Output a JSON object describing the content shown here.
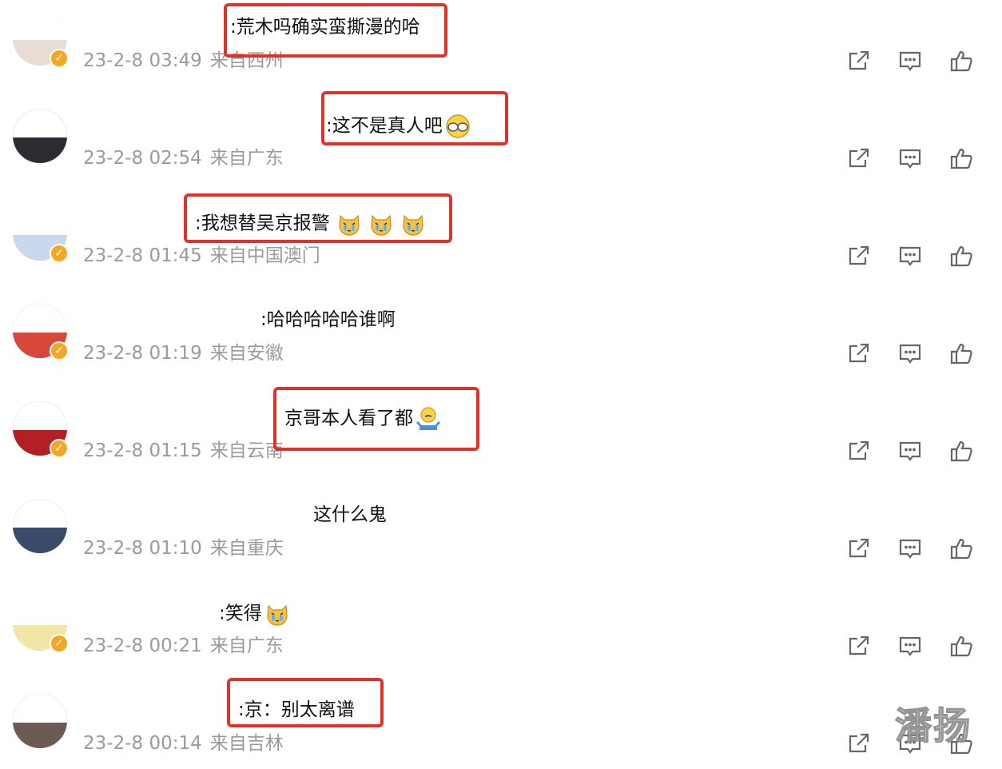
{
  "comments": [
    {
      "text": ":荒木吗确实蛮撕漫的哈",
      "time": "23-2-8 03:49",
      "location": "来自西州",
      "verified": true,
      "highlighted": true,
      "emoji": null,
      "avatar_color": "#e9dcd4"
    },
    {
      "text": ":这不是真人吧",
      "time": "23-2-8 02:54",
      "location": "来自广东",
      "verified": false,
      "highlighted": true,
      "emoji": "covering-eyes-emoji",
      "avatar_color": "#2c2c33"
    },
    {
      "text": ":我想替吴京报警",
      "time": "23-2-8 01:45",
      "location": "来自中国澳门",
      "verified": true,
      "highlighted": true,
      "emoji": "crying-dog-emoji",
      "avatar_color": "#c9d8ec"
    },
    {
      "text": ":哈哈哈哈哈谁啊",
      "time": "23-2-8 01:19",
      "location": "来自安徽",
      "verified": true,
      "highlighted": false,
      "emoji": null,
      "avatar_color": "#d9463a"
    },
    {
      "text": "京哥本人看了都",
      "time": "23-2-8 01:15",
      "location": "来自云南",
      "verified": true,
      "highlighted": true,
      "emoji": "shrug-emoji",
      "avatar_color": "#b21f24"
    },
    {
      "text": "这什么鬼",
      "time": "23-2-8 01:10",
      "location": "来自重庆",
      "verified": false,
      "highlighted": false,
      "emoji": null,
      "avatar_color": "#3a4a6a"
    },
    {
      "text": ":笑得",
      "time": "23-2-8 00:21",
      "location": "来自广东",
      "verified": true,
      "highlighted": false,
      "emoji": "crying-dog-emoji",
      "avatar_color": "#f2e6a6"
    },
    {
      "text": ":京：别太离谱",
      "time": "23-2-8 00:14",
      "location": "来自吉林",
      "verified": false,
      "highlighted": true,
      "emoji": null,
      "avatar_color": "#6b5a55"
    }
  ],
  "actions": {
    "share_icon": "share-icon",
    "reply_icon": "comment-icon",
    "like_icon": "thumbs-up-icon"
  },
  "colors": {
    "highlight_border": "#e03228",
    "meta_text": "#9a9a9a",
    "icon_stroke": "#666666",
    "verified_badge": "#f5a623"
  },
  "watermark": "潘扬"
}
